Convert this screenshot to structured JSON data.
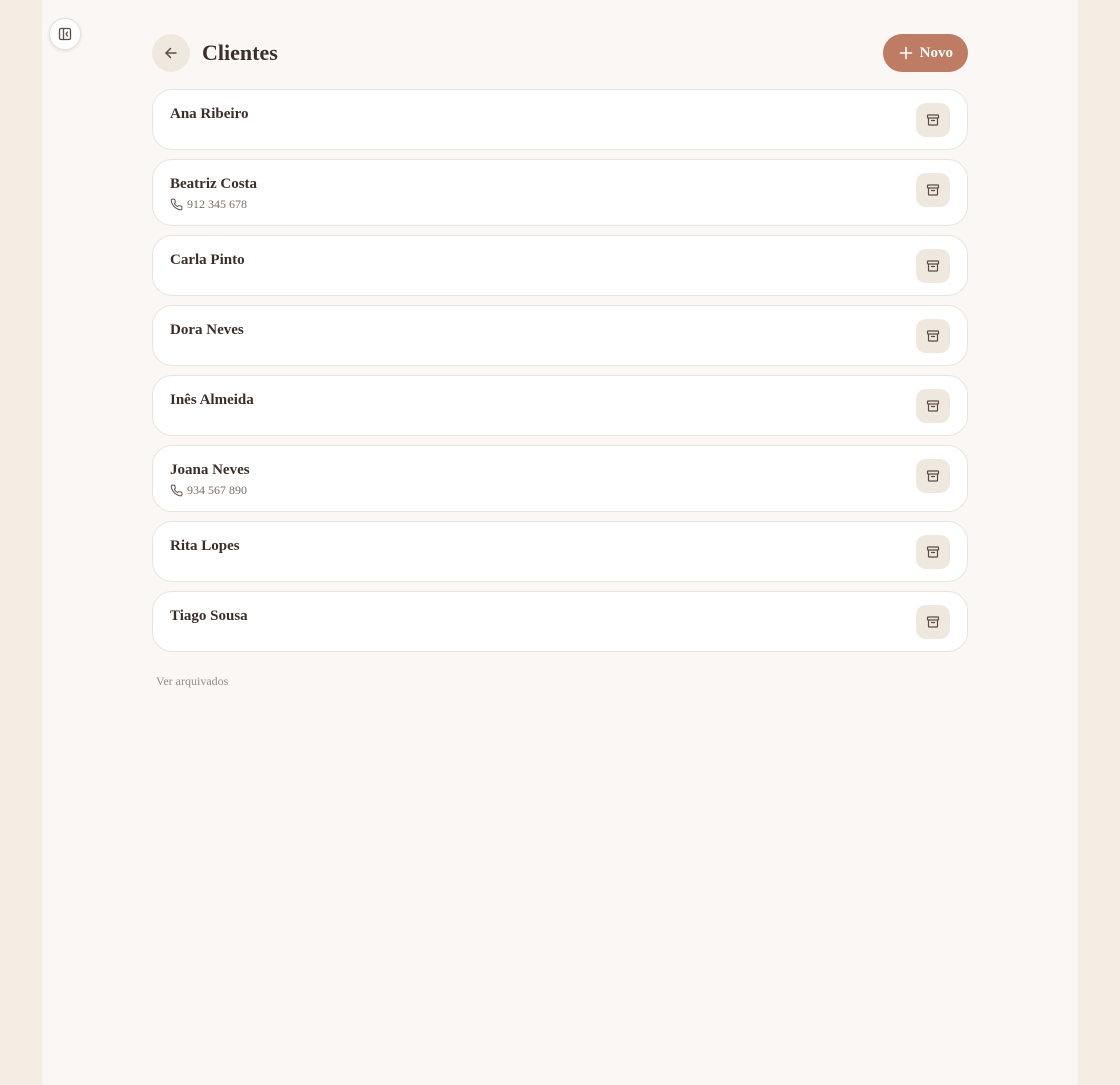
{
  "header": {
    "title": "Clientes",
    "new_label": "Novo"
  },
  "icons": {
    "sidebar_toggle": "sidebar-collapse-icon",
    "back": "arrow-left-icon",
    "new": "plus-icon",
    "archive": "archive-icon",
    "phone": "phone-icon"
  },
  "colors": {
    "accent": "#bd7c63",
    "background": "#f4ede4",
    "surface": "#faf7f4",
    "card": "#ffffff",
    "text": "#3c2f2a"
  },
  "clients": [
    {
      "name": "Ana Ribeiro",
      "phone": ""
    },
    {
      "name": "Beatriz Costa",
      "phone": "912 345 678"
    },
    {
      "name": "Carla Pinto",
      "phone": ""
    },
    {
      "name": "Dora Neves",
      "phone": ""
    },
    {
      "name": "Inês Almeida",
      "phone": ""
    },
    {
      "name": "Joana Neves",
      "phone": "934 567 890"
    },
    {
      "name": "Rita Lopes",
      "phone": ""
    },
    {
      "name": "Tiago Sousa",
      "phone": ""
    }
  ],
  "footer": {
    "view_archived_label": "Ver arquivados"
  }
}
